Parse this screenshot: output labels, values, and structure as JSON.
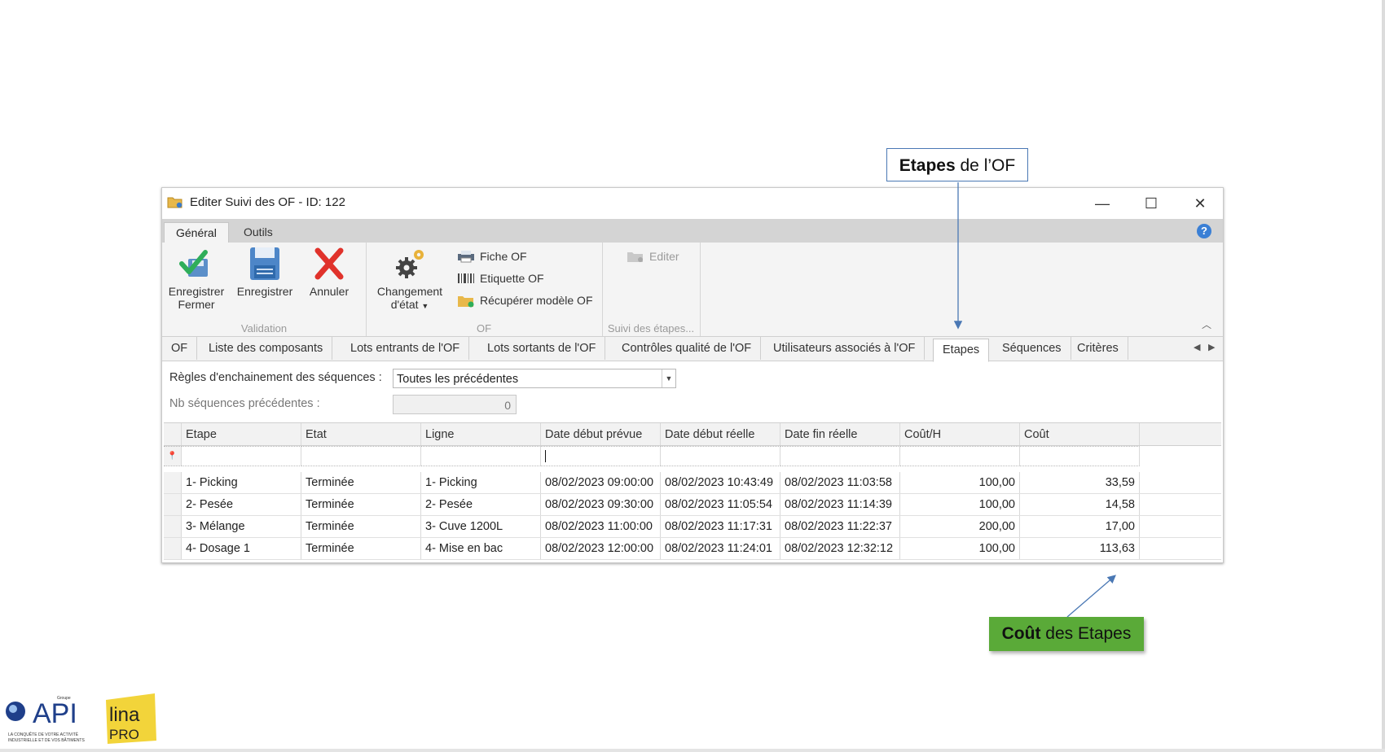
{
  "window": {
    "title": "Editer Suivi des OF - ID: 122",
    "controls": {
      "minimize": "—",
      "maximize": "☐",
      "close": "✕"
    }
  },
  "ribbon_tabs": [
    {
      "label": "Général",
      "active": true
    },
    {
      "label": "Outils",
      "active": false
    }
  ],
  "ribbon": {
    "validation": {
      "title": "Validation",
      "save_close_line1": "Enregistrer",
      "save_close_line2": "Fermer",
      "save": "Enregistrer",
      "cancel": "Annuler"
    },
    "of": {
      "title": "OF",
      "change_state_line1": "Changement",
      "change_state_line2": "d'état",
      "fiche": "Fiche OF",
      "etiquette": "Etiquette OF",
      "recuperer": "Récupérer modèle OF"
    },
    "suivi": {
      "title": "Suivi des étapes...",
      "editer": "Editer"
    }
  },
  "page_tabs": [
    "OF",
    "Liste des composants",
    "Lots entrants de l'OF",
    "Lots sortants de l'OF",
    "Contrôles qualité de l'OF",
    "Utilisateurs associés à l'OF",
    "Etapes",
    "Séquences",
    "Critères"
  ],
  "active_page_tab": "Etapes",
  "form": {
    "rules_label": "Règles d'enchainement des séquences :",
    "rules_value": "Toutes les précédentes",
    "nb_label": "Nb séquences précédentes :",
    "nb_value": "0"
  },
  "grid": {
    "columns": [
      "Etape",
      "Etat",
      "Ligne",
      "Date début prévue",
      "Date début réelle",
      "Date fin réelle",
      "Coût/H",
      "Coût"
    ],
    "rows": [
      [
        "1- Picking",
        "Terminée",
        "1- Picking",
        "08/02/2023 09:00:00",
        "08/02/2023 10:43:49",
        "08/02/2023 11:03:58",
        "100,00",
        "33,59"
      ],
      [
        "2- Pesée",
        "Terminée",
        "2- Pesée",
        "08/02/2023 09:30:00",
        "08/02/2023 11:05:54",
        "08/02/2023 11:14:39",
        "100,00",
        "14,58"
      ],
      [
        "3- Mélange",
        "Terminée",
        "3- Cuve 1200L",
        "08/02/2023 11:00:00",
        "08/02/2023 11:17:31",
        "08/02/2023 11:22:37",
        "200,00",
        "17,00"
      ],
      [
        "4- Dosage 1",
        "Terminée",
        "4- Mise en bac",
        "08/02/2023 12:00:00",
        "08/02/2023 11:24:01",
        "08/02/2023 12:32:12",
        "100,00",
        "113,63"
      ]
    ]
  },
  "callouts": {
    "etapes_bold": "Etapes",
    "etapes_rest": " de l’OF",
    "cout_bold": "Coût",
    "cout_rest": " des Etapes"
  },
  "logos": {
    "api_small": "Groupe",
    "api": "API",
    "api_tagline1": "LA CONQUÊTE DE VOTRE ACTIVITÉ",
    "api_tagline2": "INDUSTRIELLE ET DE VOS BÂTIMENTS",
    "lina": "lina",
    "pro": "PRO"
  },
  "colors": {
    "callout_border": "#4a78b4",
    "callout_green": "#5aaa38",
    "accent_blue": "#3a7fd5",
    "cancel_red": "#e0322b"
  }
}
